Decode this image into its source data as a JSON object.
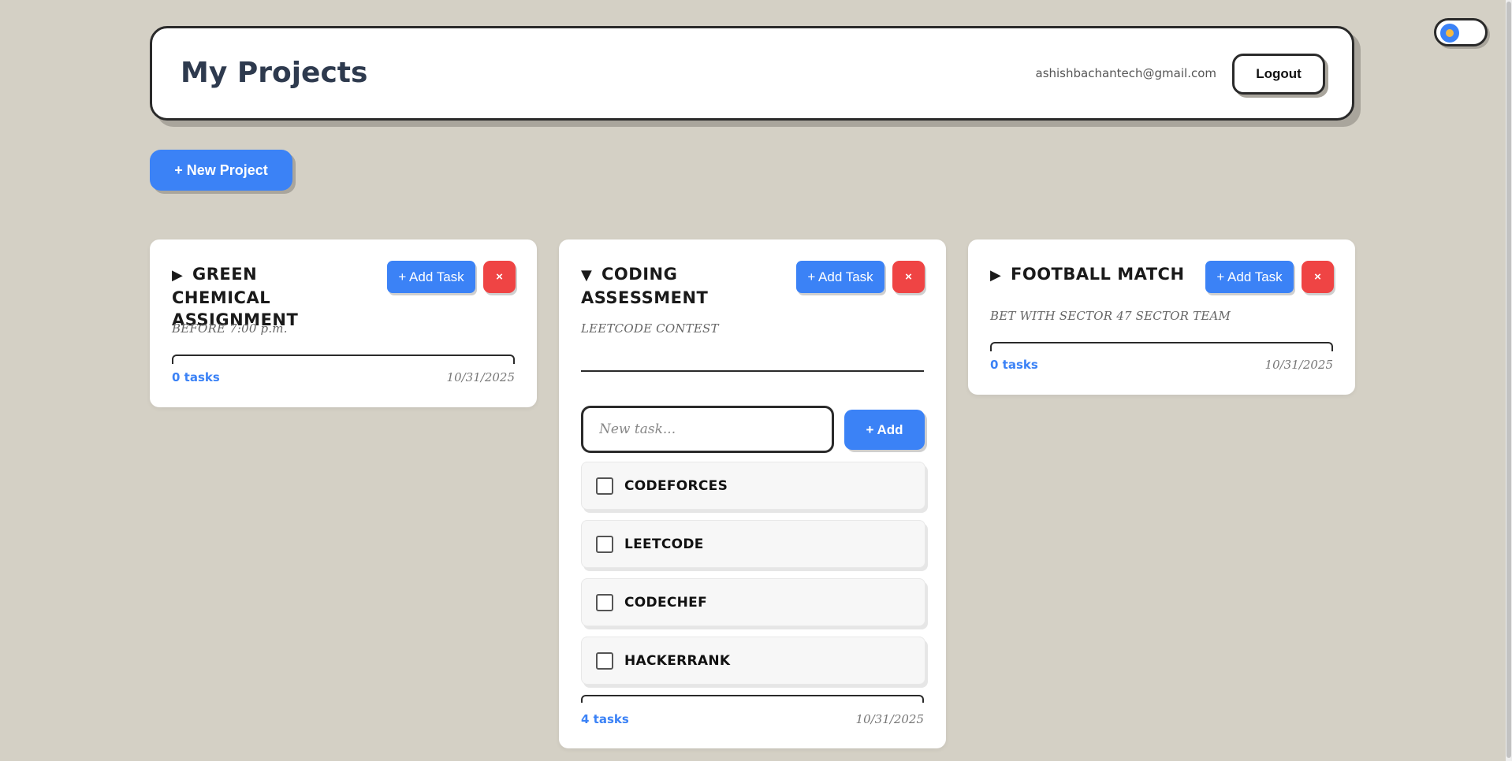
{
  "header": {
    "title": "My Projects",
    "email": "ashishbachantech@gmail.com",
    "logout_label": "Logout"
  },
  "toolbar": {
    "new_project_label": "+ New Project"
  },
  "theme_toggle": {
    "icon": "sun-icon",
    "accent": "#3b82f6"
  },
  "colors": {
    "background": "#d4d0c5",
    "primary": "#3b82f6",
    "danger": "#ef4444"
  },
  "projects": [
    {
      "title": "GREEN CHEMICAL ASSIGNMENT",
      "expanded": false,
      "toggle_icon": "▶",
      "add_task_label": "+ Add Task",
      "delete_label": "×",
      "description": "BEFORE 7:00 p.m.",
      "task_count": "0 tasks",
      "date": "10/31/2025"
    },
    {
      "title": "CODING ASSESSMENT",
      "expanded": true,
      "toggle_icon": "▼",
      "add_task_label": "+ Add Task",
      "delete_label": "×",
      "description": "LEETCODE CONTEST",
      "new_task_placeholder": "New task...",
      "add_label": "+ Add",
      "tasks": [
        {
          "label": "CODEFORCES",
          "done": false
        },
        {
          "label": "LEETCODE",
          "done": false
        },
        {
          "label": "CODECHEF",
          "done": false
        },
        {
          "label": "HACKERRANK",
          "done": false
        }
      ],
      "task_count": "4 tasks",
      "date": "10/31/2025"
    },
    {
      "title": "FOOTBALL MATCH",
      "expanded": false,
      "toggle_icon": "▶",
      "add_task_label": "+ Add Task",
      "delete_label": "×",
      "description": "BET WITH SECTOR 47 SECTOR TEAM",
      "task_count": "0 tasks",
      "date": "10/31/2025"
    }
  ]
}
